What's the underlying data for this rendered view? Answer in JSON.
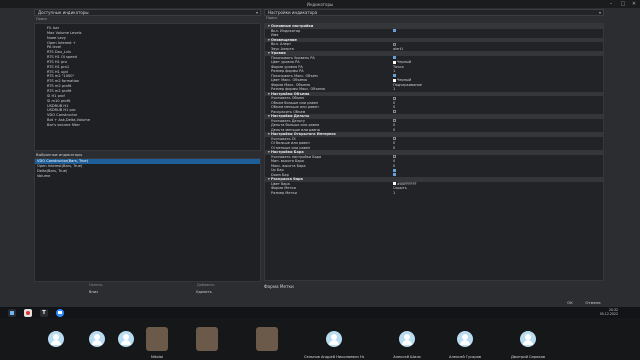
{
  "window": {
    "title": "Индикаторы"
  },
  "left": {
    "dropdown": "Доступные индикаторы",
    "search_label": "Поиск",
    "tree": [
      "Fil. bar",
      "Max Volume Levels",
      "Nuee Levy",
      "Open Interest +",
      "PA level",
      "RTS Dau_Lvls",
      "RTS H1 OI speed",
      "RTS H1 pro",
      "RTS H1 pro1",
      "RTS H1 upd",
      "RTS m2 \"1000\"",
      "RTS m2 formation",
      "RTS m2 profit",
      "RTS m2 profit",
      "SI H1 prof",
      "SI m10 profit",
      "USDRUB H1",
      "USDRUB H1 pro",
      "VDO Constructor",
      "Bot + Ask,Delta,Volume",
      "Bar's volume filter"
    ],
    "selected_label": "Выбранные индикаторы",
    "selected": [
      "VDO Constructor(Bars, True)",
      "Open Interest(Bars, True)",
      "Delta(Bars, True)",
      "Volume"
    ],
    "bottom_headers": [
      "Панель",
      "Добавить"
    ],
    "bottom_values": [
      "Вниз",
      "Удалить"
    ]
  },
  "right": {
    "dropdown": "Настройки индикатора",
    "search_label": "Поиск",
    "rows": [
      {
        "k": "Основные настройки",
        "sec": true
      },
      {
        "k": "Вкл. Индикатор",
        "v": "",
        "cb": "on"
      },
      {
        "k": "Имя",
        "v": ""
      },
      {
        "k": "Оповещение",
        "sec": true
      },
      {
        "k": "Вкл. Алерт",
        "v": "",
        "cb": "off"
      },
      {
        "k": "Звук Алерта",
        "v": "alert1"
      },
      {
        "k": "Уровни",
        "sec": true
      },
      {
        "k": "Показывать Уровень РА",
        "v": "",
        "cb": "on"
      },
      {
        "k": "Цвет уровня РА",
        "v": "Черный",
        "sw": true
      },
      {
        "k": "Форма уровня РА",
        "v": "Точка"
      },
      {
        "k": "Размер формы РА",
        "v": "1"
      },
      {
        "k": "Показывать Макс. Объем",
        "v": "",
        "cb": "on"
      },
      {
        "k": "Цвет Макс. Объема",
        "v": "Черный",
        "sw": true
      },
      {
        "k": "Форма Макс. Объема",
        "v": "Подчеркивание"
      },
      {
        "k": "Размер формы Макс. Объема",
        "v": "1"
      },
      {
        "k": "Настройки Объема",
        "sec": true
      },
      {
        "k": "Учитывать Объем",
        "v": "",
        "cb": "off"
      },
      {
        "k": "Объем больше или равен",
        "v": "0"
      },
      {
        "k": "Объем меньше или равен",
        "v": "0"
      },
      {
        "k": "Раскрасить Объем",
        "v": "",
        "cb": "off"
      },
      {
        "k": "Настройки Дельты",
        "sec": true
      },
      {
        "k": "Учитывать Дельту",
        "v": "",
        "cb": "off"
      },
      {
        "k": "Дельта больше или равна",
        "v": "0"
      },
      {
        "k": "Дельта меньше или равна",
        "v": "0"
      },
      {
        "k": "Настройки Открытого Интереса",
        "sec": true
      },
      {
        "k": "Учитывать OI",
        "v": "",
        "cb": "off"
      },
      {
        "k": "OI больше или равен",
        "v": "0"
      },
      {
        "k": "OI меньше или равен",
        "v": "0"
      },
      {
        "k": "Настройки Бара",
        "sec": true
      },
      {
        "k": "Учитывать настройки Бара",
        "v": "",
        "cb": "off"
      },
      {
        "k": "Мин. высота Бара",
        "v": "0"
      },
      {
        "k": "Макс. высота Бара",
        "v": "0"
      },
      {
        "k": "Up Бар",
        "v": "",
        "cb": "on"
      },
      {
        "k": "Down Бар",
        "v": "",
        "cb": "on"
      },
      {
        "k": "Раскраска бара",
        "sec": true
      },
      {
        "k": "Цвет бара",
        "v": "#00FFFFFF",
        "sw": true
      },
      {
        "k": "Форма Метки",
        "v": "Скрыть"
      },
      {
        "k": "Размер Метки",
        "v": "1"
      }
    ],
    "description": "Форма Метки"
  },
  "buttons": {
    "ok": "OK",
    "cancel": "Отмена"
  },
  "clock": {
    "time": "20:32",
    "date": "05.12.2022"
  },
  "participants": [
    {
      "name": "",
      "type": "avatar"
    },
    {
      "name": "",
      "type": "avatar"
    },
    {
      "name": "",
      "type": "avatar"
    },
    {
      "name": "Nikolai",
      "type": "photo"
    },
    {
      "name": "",
      "type": "photo"
    },
    {
      "name": "",
      "type": "photo"
    },
    {
      "name": "Сельнов Андрей Николаевич Новгород",
      "type": "avatar"
    },
    {
      "name": "Алексей Шило",
      "type": "avatar"
    },
    {
      "name": "Алексей Гусаров",
      "type": "avatar"
    },
    {
      "name": "Дмитрий Сириков",
      "type": "avatar"
    }
  ]
}
